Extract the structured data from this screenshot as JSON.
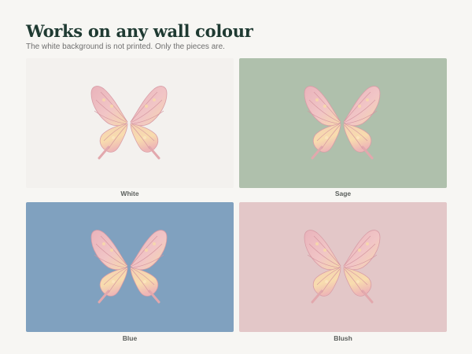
{
  "page": {
    "title": "Works on any wall colour",
    "subtitle": "The white background is not printed. Only the pieces are."
  },
  "swatches": [
    {
      "label": "White",
      "color": "#f3f1ee"
    },
    {
      "label": "Sage",
      "color": "#afc0ac"
    },
    {
      "label": "Blue",
      "color": "#80a1bf"
    },
    {
      "label": "Blush",
      "color": "#e3c7c8"
    }
  ],
  "butterfly": {
    "icon": "butterfly-icon",
    "wing_color": "#f0c9cb",
    "wing_accent": "#f7dba7",
    "vein_color": "#d49aa2"
  }
}
